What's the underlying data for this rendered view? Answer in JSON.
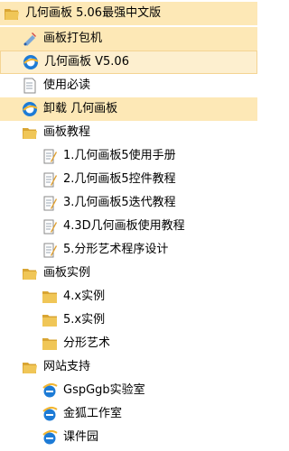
{
  "colors": {
    "highlight": "#fde8b6",
    "folder": "#f0c657",
    "folder_dark": "#d9a533",
    "ie_blue": "#1d7bd6",
    "ie_gold": "#f2b632"
  },
  "root": {
    "label": "几何画板 5.06最强中文版",
    "icon": "folder-open-icon",
    "items": [
      {
        "label": "画板打包机",
        "icon": "packer-icon"
      },
      {
        "label": "几何画板 V5.06",
        "icon": "gsp-app-icon"
      },
      {
        "label": "使用必读",
        "icon": "document-icon"
      },
      {
        "label": "卸载 几何画板",
        "icon": "gsp-app-icon"
      }
    ]
  },
  "groups": [
    {
      "label": "画板教程",
      "icon": "folder-open-icon",
      "items": [
        {
          "label": "1.几何画板5使用手册",
          "icon": "notepad-document-icon"
        },
        {
          "label": "2.几何画板5控件教程",
          "icon": "notepad-document-icon"
        },
        {
          "label": "3.几何画板5迭代教程",
          "icon": "notepad-document-icon"
        },
        {
          "label": "4.3D几何画板使用教程",
          "icon": "notepad-document-icon"
        },
        {
          "label": "5.分形艺术程序设计",
          "icon": "notepad-document-icon"
        }
      ]
    },
    {
      "label": "画板实例",
      "icon": "folder-open-icon",
      "items": [
        {
          "label": "4.x实例",
          "icon": "folder-icon"
        },
        {
          "label": "5.x实例",
          "icon": "folder-icon"
        },
        {
          "label": "分形艺术",
          "icon": "folder-icon"
        }
      ]
    },
    {
      "label": "网站支持",
      "icon": "folder-open-icon",
      "items": [
        {
          "label": "GspGgb实验室",
          "icon": "internet-explorer-icon"
        },
        {
          "label": "金狐工作室",
          "icon": "internet-explorer-icon"
        },
        {
          "label": "课件园",
          "icon": "internet-explorer-icon"
        }
      ]
    }
  ]
}
